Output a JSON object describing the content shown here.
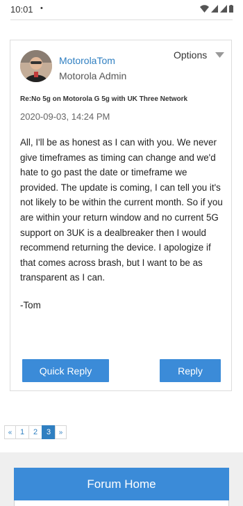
{
  "status_bar": {
    "time": "10:01",
    "dot": "•",
    "icons": [
      "wifi-icon",
      "signal-icon",
      "signal-icon",
      "battery-icon"
    ]
  },
  "post": {
    "author": {
      "name": "MotorolaTom",
      "role": "Motorola Admin",
      "avatar_icon": "user-avatar"
    },
    "options_label": "Options",
    "subject": "Re:No 5g on Motorola G 5g with UK Three Network",
    "date": "2020-09-03, 14:24 PM",
    "body": "All, I'll be as honest as I can with you. We never give timeframes as timing can change and we'd hate to go past the date or timeframe we provided. The update is coming, I can tell you it's not likely to be within the current month. So if you are within your return window and no current 5G support on 3UK is a dealbreaker then I would recommend returning the device. I apologize if that comes across brash, but I want to be as transparent as I can.",
    "signature": "-Tom",
    "quick_reply_label": "Quick Reply",
    "reply_label": "Reply"
  },
  "pagination": {
    "prev": "«",
    "pages": [
      "1",
      "2",
      "3"
    ],
    "active_page": "3",
    "next": "»"
  },
  "footer": {
    "forum_home_label": "Forum Home"
  },
  "colors": {
    "accent": "#3b8bd8",
    "link": "#2f7fc1"
  }
}
